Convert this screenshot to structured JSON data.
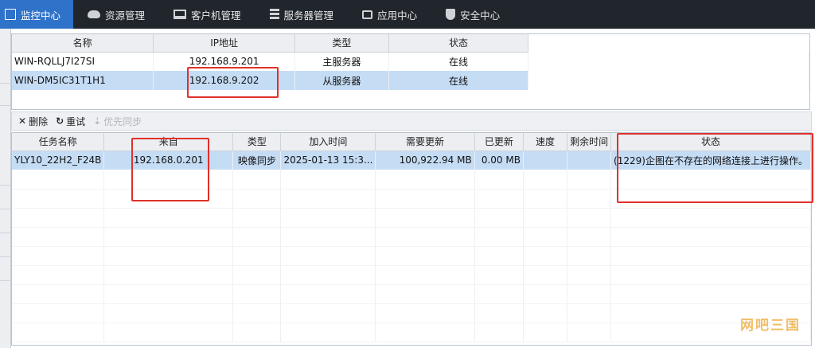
{
  "nav": {
    "items": [
      {
        "label": "监控中心",
        "icon": "monitor-icon",
        "active": true
      },
      {
        "label": "资源管理",
        "icon": "cloud-icon"
      },
      {
        "label": "客户机管理",
        "icon": "screen-icon"
      },
      {
        "label": "服务器管理",
        "icon": "server-icon"
      },
      {
        "label": "应用中心",
        "icon": "box-icon"
      },
      {
        "label": "安全中心",
        "icon": "shield-icon"
      }
    ]
  },
  "servers": {
    "columns": [
      "名称",
      "IP地址",
      "类型",
      "状态"
    ],
    "rows": [
      {
        "name": "WIN-RQLLJ7I27SI",
        "ip": "192.168.9.201",
        "type": "主服务器",
        "status": "在线"
      },
      {
        "name": "WIN-DM5IC31T1H1",
        "ip": "192.168.9.202",
        "type": "从服务器",
        "status": "在线"
      }
    ]
  },
  "toolbar": {
    "delete_label": "删除",
    "retry_label": "重试",
    "priority_label": "优先同步"
  },
  "tasks": {
    "columns": [
      "任务名称",
      "来自",
      "类型",
      "加入时间",
      "需要更新",
      "已更新",
      "速度",
      "剩余时间",
      "状态"
    ],
    "rows": [
      {
        "name": "YLY10_22H2_F24B",
        "from": "192.168.0.201",
        "type": "映像同步",
        "added": "2025-01-13 15:3...",
        "needed": "100,922.94 MB",
        "updated": "0.00 MB",
        "speed": "",
        "remaining": "",
        "status": "(1229)企图在不存在的网络连接上进行操作。"
      }
    ]
  },
  "watermark": "网吧三国",
  "colors": {
    "accent": "#2f72c9",
    "annotation": "#e0302a",
    "selection": "#c5dcf5"
  }
}
